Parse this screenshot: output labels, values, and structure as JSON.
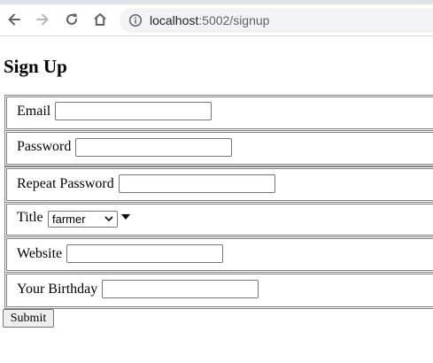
{
  "browser": {
    "url_host": "localhost",
    "url_path": ":5002/signup"
  },
  "page": {
    "title": "Sign Up"
  },
  "form": {
    "email": {
      "label": "Email",
      "value": ""
    },
    "password": {
      "label": "Password",
      "value": ""
    },
    "repeat_password": {
      "label": "Repeat Password",
      "value": ""
    },
    "title": {
      "label": "Title",
      "selected": "farmer"
    },
    "website": {
      "label": "Website",
      "value": ""
    },
    "birthday": {
      "label": "Your Birthday",
      "value": ""
    },
    "submit_label": "Submit"
  },
  "icons": {
    "back": "back-arrow-icon",
    "forward": "forward-arrow-icon",
    "reload": "reload-icon",
    "home": "home-icon",
    "site_info": "info-icon",
    "dropdown": "dropdown-caret-icon"
  },
  "colors": {
    "chrome_bg": "#dee1e6",
    "omnibox_bg": "#f1f3f4",
    "border": "#808080",
    "button_bg": "#efefef"
  }
}
